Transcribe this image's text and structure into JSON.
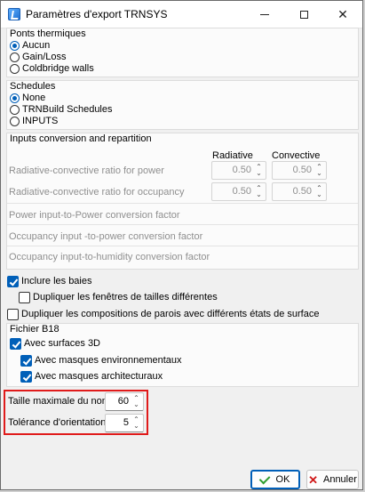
{
  "window": {
    "title": "Paramètres d'export TRNSYS"
  },
  "thermal_bridges": {
    "label": "Ponts thermiques",
    "options": [
      "Aucun",
      "Gain/Loss",
      "Coldbridge walls"
    ],
    "selected": "Aucun"
  },
  "schedules": {
    "label": "Schedules",
    "options": [
      "None",
      "TRNBuild Schedules",
      "INPUTS"
    ],
    "selected": "None"
  },
  "inputs": {
    "label": "Inputs conversion and repartition",
    "col_radiative": "Radiative",
    "col_convective": "Convective",
    "rows": [
      {
        "label": "Radiative-convective ratio for power",
        "radiative": "0.50",
        "convective": "0.50"
      },
      {
        "label": "Radiative-convective ratio for occupancy",
        "radiative": "0.50",
        "convective": "0.50"
      }
    ],
    "factors": [
      "Power input-to-Power conversion factor",
      "Occupancy input -to-power conversion factor",
      "Occupancy input-to-humidity conversion factor"
    ]
  },
  "options": {
    "include_bays": {
      "label": "Inclure les baies",
      "checked": true
    },
    "duplicate_windows": {
      "label": "Dupliquer les fenêtres de tailles différentes",
      "checked": false
    },
    "duplicate_walls": {
      "label": "Dupliquer les compositions de parois avec différents états de surface",
      "checked": false
    }
  },
  "b18": {
    "label": "Fichier B18",
    "surfaces_3d": {
      "label": "Avec surfaces 3D",
      "checked": true
    },
    "env_masks": {
      "label": "Avec masques environnementaux",
      "checked": true
    },
    "arch_masks": {
      "label": "Avec masques architecturaux",
      "checked": true
    }
  },
  "limits": {
    "max_name_label": "Taille maximale du nom",
    "max_name_value": "60",
    "orientation_label": "Tolérance d'orientation",
    "orientation_value": "5"
  },
  "buttons": {
    "ok": "OK",
    "cancel": "Annuler"
  },
  "colors": {
    "accent": "#005fb8",
    "highlight": "#e01b1b",
    "disabled_text": "#8f8f8f"
  }
}
